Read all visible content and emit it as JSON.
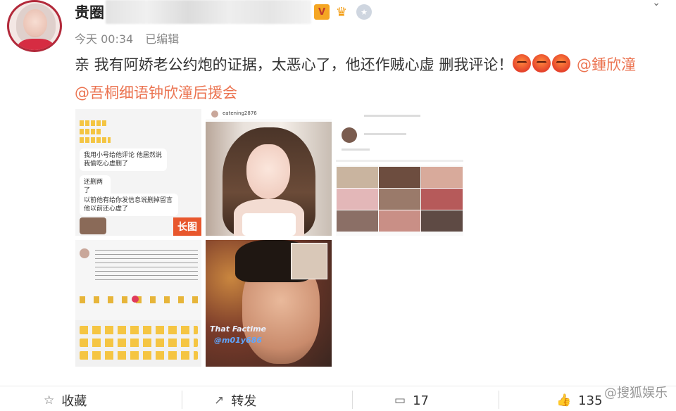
{
  "post": {
    "username": "贵圈",
    "timestamp": "今天 00:34",
    "edited_label": "已编辑",
    "text_main": "亲 我有阿娇老公约炮的证据，太恶心了，他还作贼心虚 删我评论！",
    "mention_1": "@鍾欣潼",
    "mention_2": "@吾桐细语钟欣潼后援会",
    "badges": [
      "verified-v-icon",
      "crown-icon",
      "medal-icon"
    ]
  },
  "images": {
    "img1": {
      "bubble_1": "我用小号给他评论 他居然说我偷吃心虚删了",
      "bubble_2": "还删两了",
      "bubble_3": "以前他有给你发信息说删掉留言 他以前还心虚了",
      "long_image_label": "长图"
    },
    "img2": {
      "handle": "eatening2876"
    },
    "img5": {
      "caption_1": "That Factime",
      "caption_2": "@m01y686"
    }
  },
  "footer": {
    "favorite_label": "收藏",
    "repost_label": "转发",
    "comment_count": "17",
    "like_count": "135",
    "watermark": "@搜狐娱乐"
  },
  "colors": {
    "mention": "#eb7350",
    "avatar_border": "#b2293a",
    "long_label_bg": "#e8572d"
  }
}
